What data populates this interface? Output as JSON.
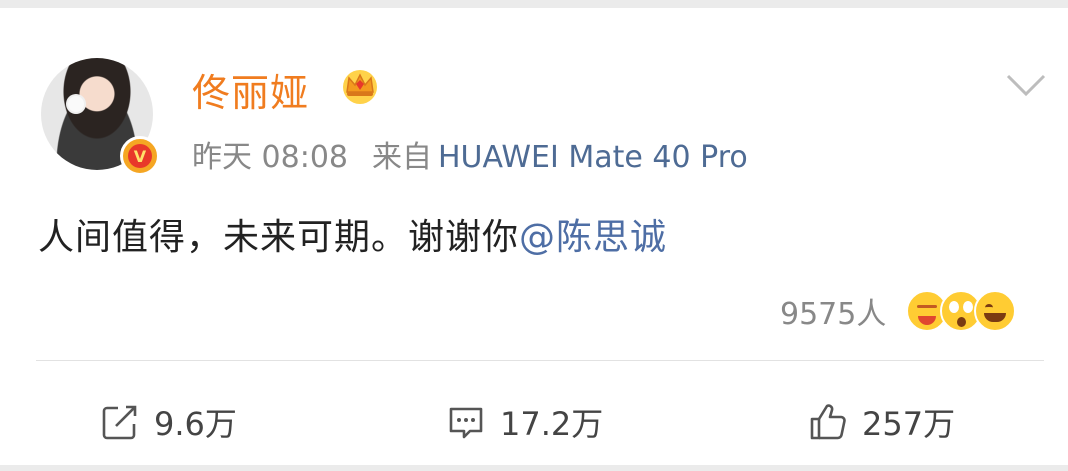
{
  "post": {
    "username": "佟丽娅",
    "timestamp": "昨天 08:08",
    "source_prefix": "来自",
    "device": "HUAWEI Mate 40 Pro",
    "body_text": "人间值得，未来可期。谢谢你",
    "mention": "@陈思诚",
    "verified_badge": "V"
  },
  "reactions": {
    "count": "9575人",
    "emojis": [
      "laughing-tongue-icon",
      "surprised-icon",
      "grin-icon"
    ]
  },
  "actions": {
    "repost_count": "9.6万",
    "comment_count": "17.2万",
    "like_count": "257万"
  },
  "colors": {
    "username": "#f07c1f",
    "link": "#4e6ea5",
    "muted": "#888888"
  }
}
